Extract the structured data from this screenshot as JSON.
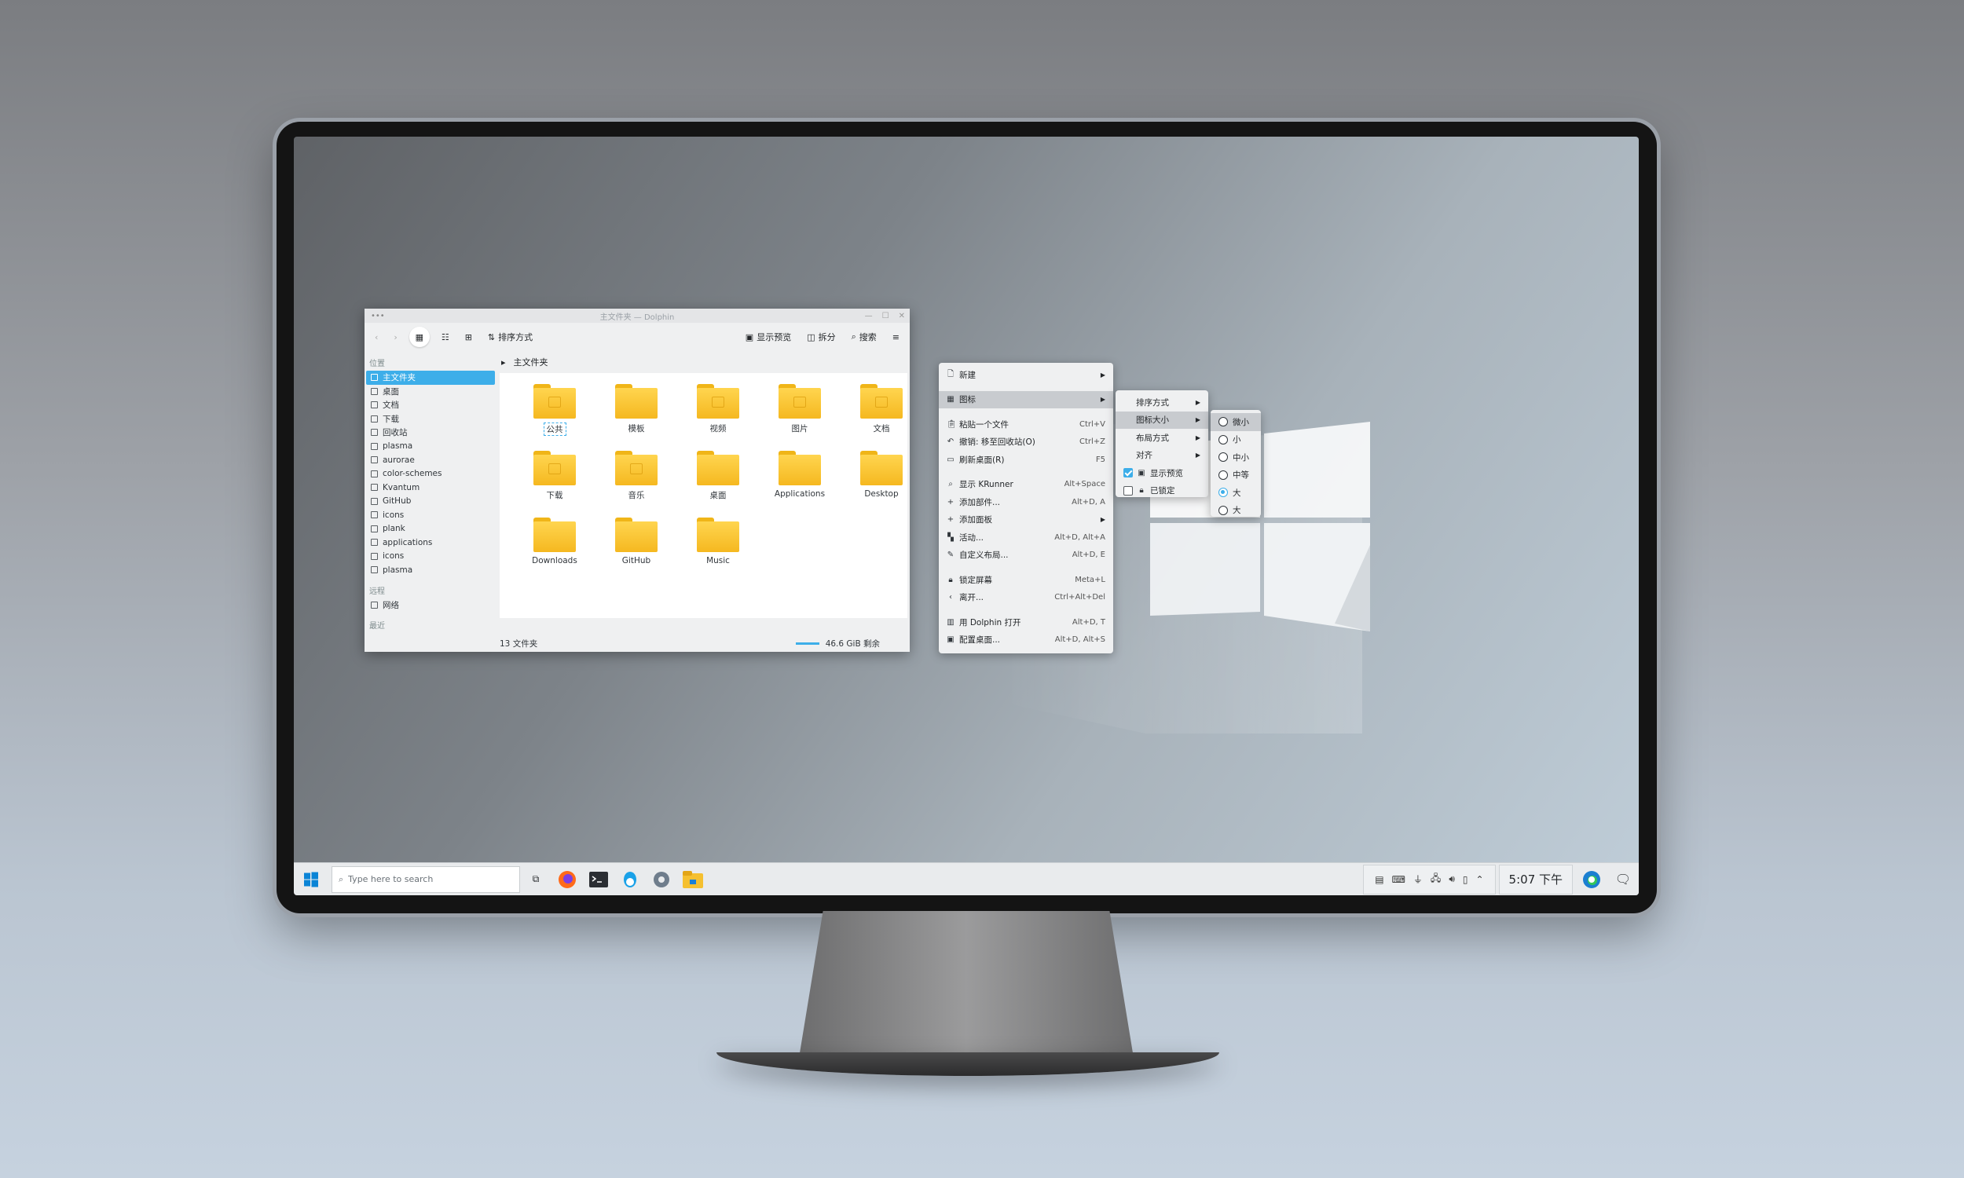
{
  "dolphin": {
    "title": "主文件夹 — Dolphin",
    "toolbar": {
      "sort": "排序方式",
      "preview": "显示预览",
      "split": "拆分",
      "search": "搜索"
    },
    "sections": {
      "places": "位置",
      "remote": "远程",
      "recent": "最近"
    },
    "places": [
      "主文件夹",
      "桌面",
      "文档",
      "下载",
      "回收站",
      "plasma",
      "aurorae",
      "color-schemes",
      "Kvantum",
      "GitHub",
      "icons",
      "plank",
      "applications",
      "icons",
      "plasma"
    ],
    "remote": [
      "网络"
    ],
    "breadcrumb": "主文件夹",
    "folders": [
      "公共",
      "模板",
      "视频",
      "图片",
      "文档",
      "下载",
      "音乐",
      "桌面",
      "Applications",
      "Desktop",
      "Downloads",
      "GitHub",
      "Music"
    ],
    "status": {
      "count": "13 文件夹",
      "free": "46.6 GiB 剩余"
    }
  },
  "context_menu": {
    "items": [
      {
        "label": "新建",
        "key": "",
        "sub": true,
        "icon": "new-icon"
      },
      {
        "label": "图标",
        "key": "",
        "sub": true,
        "icon": "icons-icon",
        "hl": true
      },
      {
        "label": "粘贴一个文件",
        "key": "Ctrl+V",
        "icon": "paste-icon"
      },
      {
        "label": "撤销: 移至回收站(O)",
        "key": "Ctrl+Z",
        "icon": "undo-icon"
      },
      {
        "label": "刷新桌面(R)",
        "key": "F5",
        "icon": "refresh-icon"
      },
      {
        "label": "显示 KRunner",
        "key": "Alt+Space",
        "icon": "krunner-icon"
      },
      {
        "label": "添加部件...",
        "key": "Alt+D, A",
        "icon": "add-icon"
      },
      {
        "label": "添加面板",
        "key": "",
        "sub": true,
        "icon": "add-icon"
      },
      {
        "label": "活动...",
        "key": "Alt+D, Alt+A",
        "icon": "activities-icon"
      },
      {
        "label": "自定义布局...",
        "key": "Alt+D, E",
        "icon": "edit-icon"
      },
      {
        "label": "锁定屏幕",
        "key": "Meta+L",
        "icon": "lock-icon"
      },
      {
        "label": "离开...",
        "key": "Ctrl+Alt+Del",
        "icon": "leave-icon"
      },
      {
        "label": "用 Dolphin 打开",
        "key": "Alt+D, T",
        "icon": "dolphin-icon"
      },
      {
        "label": "配置桌面...",
        "key": "Alt+D, Alt+S",
        "icon": "configure-icon"
      }
    ],
    "icons_sub": {
      "sort": "排序方式",
      "size": "图标大小",
      "layout": "布局方式",
      "align": "对齐",
      "preview": "显示预览",
      "locked": "已锁定"
    },
    "size_sub": [
      "微小",
      "小",
      "中小",
      "中等",
      "大",
      "大"
    ],
    "size_selected": 4
  },
  "taskbar": {
    "search_placeholder": "Type here to search",
    "clock": "5:07 下午"
  }
}
